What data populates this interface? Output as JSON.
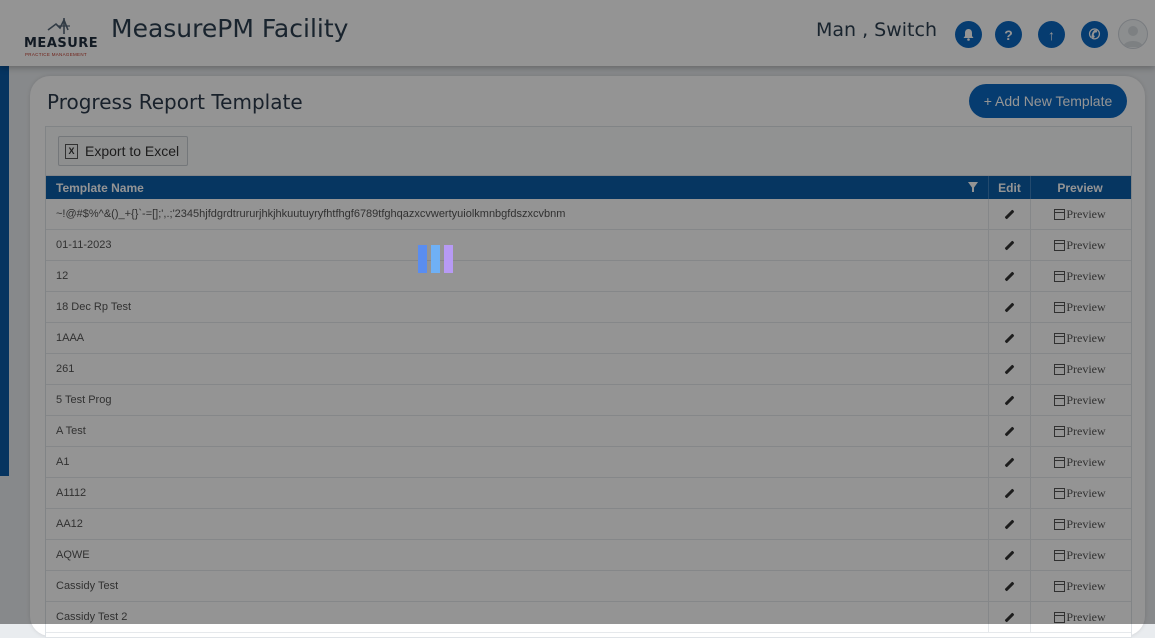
{
  "app": {
    "title": "MeasurePM Facility",
    "logo_word": "MEASURE",
    "logo_tagline": "PRACTICE MANAGEMENT"
  },
  "header": {
    "user_label": "Man , Switch",
    "buttons": [
      {
        "icon": "bell-icon",
        "glyph": "🔔"
      },
      {
        "icon": "help-icon",
        "glyph": "?"
      },
      {
        "icon": "upload-icon",
        "glyph": "↑"
      },
      {
        "icon": "phone-icon",
        "glyph": "✆"
      }
    ]
  },
  "page": {
    "title": "Progress Report Template",
    "add_button": "+ Add New Template",
    "export_button": "Export to Excel"
  },
  "table": {
    "columns": {
      "name": "Template Name",
      "edit": "Edit",
      "preview": "Preview"
    },
    "preview_label": "Preview",
    "rows": [
      "~!@#$%^&()_+{}`-=[];',.;'2345hjfdgrdtrururjhkjhkuutuyryfhtfhgf6789tfghqazxcvwertyuiolkmnbgfdszxcvbnm",
      "01-11-2023",
      "12",
      "18 Dec Rp Test",
      "1AAA",
      "261",
      "5 Test Prog",
      "A Test",
      "A1",
      "A1112",
      "AA12",
      "AQWE",
      "Cassidy Test",
      "Cassidy Test 2"
    ]
  },
  "colors": {
    "primary": "#0b68c2",
    "header_bg": "#0c5ea8",
    "loader": [
      "#5a8df0",
      "#6fb0f5",
      "#b79af5"
    ]
  }
}
